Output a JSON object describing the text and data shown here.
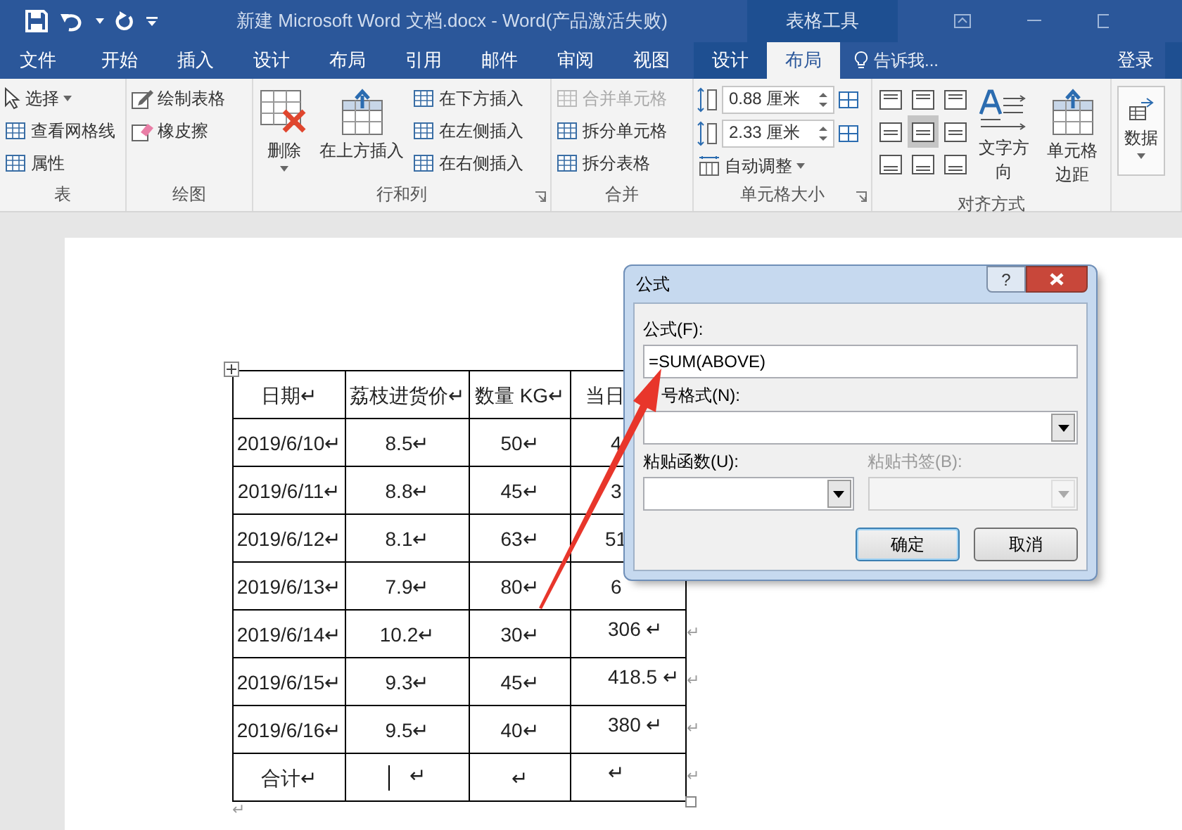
{
  "title_bar": {
    "title": "新建 Microsoft Word 文档.docx - Word(产品激活失败)",
    "context_label": "表格工具"
  },
  "tabs": [
    {
      "label": "文件",
      "selected": false,
      "context": false
    },
    {
      "label": "开始",
      "selected": false,
      "context": false
    },
    {
      "label": "插入",
      "selected": false,
      "context": false
    },
    {
      "label": "设计",
      "selected": false,
      "context": false
    },
    {
      "label": "布局",
      "selected": false,
      "context": false
    },
    {
      "label": "引用",
      "selected": false,
      "context": false
    },
    {
      "label": "邮件",
      "selected": false,
      "context": false
    },
    {
      "label": "审阅",
      "selected": false,
      "context": false
    },
    {
      "label": "视图",
      "selected": false,
      "context": false
    },
    {
      "label": "设计",
      "selected": false,
      "context": true
    },
    {
      "label": "布局",
      "selected": true,
      "context": true
    }
  ],
  "tell_me": {
    "placeholder": "告诉我..."
  },
  "sign_in": "登录",
  "ribbon": [
    {
      "label": "表",
      "launcher": false,
      "items": [
        {
          "kind": "small",
          "label": "选择",
          "dropdown": true,
          "disabled": false
        },
        {
          "kind": "small",
          "label": "查看网格线",
          "dropdown": false,
          "disabled": false
        },
        {
          "kind": "small",
          "label": "属性",
          "dropdown": false,
          "disabled": false
        }
      ]
    },
    {
      "label": "绘图",
      "launcher": false,
      "items": [
        {
          "kind": "small",
          "label": "绘制表格",
          "dropdown": false,
          "disabled": false
        },
        {
          "kind": "small",
          "label": "橡皮擦",
          "dropdown": false,
          "disabled": false
        }
      ]
    },
    {
      "label": "行和列",
      "launcher": true,
      "items": [
        {
          "kind": "large",
          "label": "删除",
          "dropdown": true,
          "disabled": false
        },
        {
          "kind": "large",
          "label": "在上方插入",
          "dropdown": false,
          "disabled": false
        },
        {
          "kind": "small",
          "label": "在下方插入",
          "dropdown": false,
          "disabled": false
        },
        {
          "kind": "small",
          "label": "在左侧插入",
          "dropdown": false,
          "disabled": false
        },
        {
          "kind": "small",
          "label": "在右侧插入",
          "dropdown": false,
          "disabled": false
        }
      ]
    },
    {
      "label": "合并",
      "launcher": false,
      "items": [
        {
          "kind": "small",
          "label": "合并单元格",
          "dropdown": false,
          "disabled": true
        },
        {
          "kind": "small",
          "label": "拆分单元格",
          "dropdown": false,
          "disabled": false
        },
        {
          "kind": "small",
          "label": "拆分表格",
          "dropdown": false,
          "disabled": false
        }
      ]
    },
    {
      "label": "单元格大小",
      "launcher": true,
      "items": [
        {
          "kind": "spin",
          "value": "0.88 厘米"
        },
        {
          "kind": "spin",
          "value": "2.33 厘米"
        },
        {
          "kind": "small",
          "label": "自动调整",
          "dropdown": true,
          "disabled": false
        }
      ]
    },
    {
      "label": "对齐方式",
      "launcher": false,
      "items": [
        {
          "kind": "align_grid",
          "cells": [
            {
              "selected": false
            },
            {
              "selected": false
            },
            {
              "selected": false
            },
            {
              "selected": false
            },
            {
              "selected": true
            },
            {
              "selected": false
            },
            {
              "selected": false
            },
            {
              "selected": false
            },
            {
              "selected": false
            }
          ]
        },
        {
          "kind": "large",
          "label": "文字方向",
          "dropdown": false,
          "disabled": false
        },
        {
          "kind": "large",
          "label": "单元格边距",
          "dropdown": false,
          "disabled": false
        }
      ]
    },
    {
      "launcher": false,
      "items": [
        {
          "kind": "large",
          "label": "数据",
          "dropdown": true,
          "disabled": false
        }
      ]
    }
  ],
  "table": {
    "rows": [
      {
        "cells": [
          "日期↵",
          "荔枝进货价↵",
          "数量 KG↵",
          "当日"
        ]
      },
      {
        "cells": [
          "2019/6/10↵",
          "8.5↵",
          "50↵",
          "4"
        ]
      },
      {
        "cells": [
          "2019/6/11↵",
          "8.8↵",
          "45↵",
          "3"
        ]
      },
      {
        "cells": [
          "2019/6/12↵",
          "8.1↵",
          "63↵",
          "51"
        ]
      },
      {
        "cells": [
          "2019/6/13↵",
          "7.9↵",
          "80↵",
          "6"
        ]
      },
      {
        "cells": [
          "2019/6/14↵",
          "10.2↵",
          "30↵",
          "306 ↵"
        ],
        "end": "↵"
      },
      {
        "cells": [
          "2019/6/15↵",
          "9.3↵",
          "45↵",
          "418.5 ↵"
        ],
        "end": "↵"
      },
      {
        "cells": [
          "2019/6/16↵",
          "9.5↵",
          "40↵",
          "380 ↵"
        ],
        "end": "↵"
      },
      {
        "cells": [
          "合计↵",
          "↵",
          "↵",
          "↵"
        ],
        "end": "↵",
        "cursor": [
          false,
          true,
          false,
          false
        ]
      }
    ],
    "after_mark": "↵"
  },
  "dialog": {
    "title": "公式",
    "help": "?",
    "formula_label": "公式(F):",
    "formula": "=SUM(ABOVE)",
    "format_label": "号格式(N):",
    "function_label": "粘贴函数(U):",
    "bookmark_label": "粘贴书签(B):",
    "bookmark_disabled": true,
    "buttons": [
      {
        "label": "确定",
        "default": true
      },
      {
        "label": "取消",
        "default": false
      }
    ]
  }
}
